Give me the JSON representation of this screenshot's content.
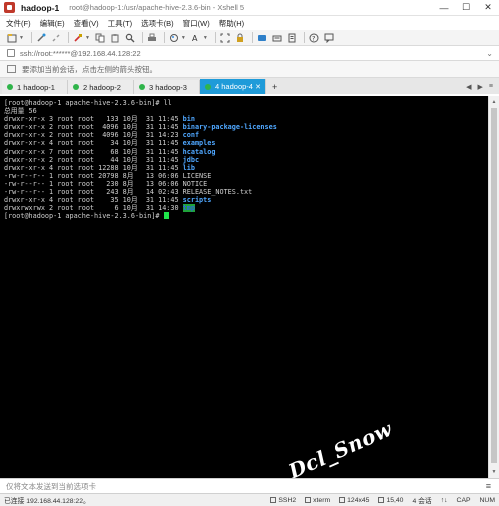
{
  "window": {
    "name": "hadoop-1",
    "path": "root@hadoop-1:/usr/apache-hive-2.3.6-bin - Xshell 5"
  },
  "controls": {
    "minimize": "—",
    "maximize": "☐",
    "close": "✕"
  },
  "menu": [
    "文件(F)",
    "编辑(E)",
    "查看(V)",
    "工具(T)",
    "选项卡(B)",
    "窗口(W)",
    "帮助(H)"
  ],
  "address": {
    "text": "ssh://root:******@192.168.44.128:22"
  },
  "info": {
    "text": "要添加当前会话，点击左侧的箭头按钮。"
  },
  "tabs": [
    {
      "label": "1 hadoop-1",
      "active": false
    },
    {
      "label": "2 hadoop-2",
      "active": false
    },
    {
      "label": "3 hadoop-3",
      "active": false
    },
    {
      "label": "4 hadoop-4",
      "active": true
    }
  ],
  "tab_add": "+",
  "terminal": {
    "prompt_first": "[root@hadoop-1 apache-hive-2.3.6-bin]# ll",
    "total": "总用量 56",
    "rows": [
      {
        "prefix": "drwxr-xr-x 3 root root   133 10月  31 11:45 ",
        "name": "bin",
        "kind": "dir"
      },
      {
        "prefix": "drwxr-xr-x 2 root root  4096 10月  31 11:45 ",
        "name": "binary-package-licenses",
        "kind": "dir"
      },
      {
        "prefix": "drwxr-xr-x 2 root root  4096 10月  31 14:23 ",
        "name": "conf",
        "kind": "dir"
      },
      {
        "prefix": "drwxr-xr-x 4 root root    34 10月  31 11:45 ",
        "name": "examples",
        "kind": "dir"
      },
      {
        "prefix": "drwxr-xr-x 7 root root    68 10月  31 11:45 ",
        "name": "hcatalog",
        "kind": "dir"
      },
      {
        "prefix": "drwxr-xr-x 2 root root    44 10月  31 11:45 ",
        "name": "jdbc",
        "kind": "dir"
      },
      {
        "prefix": "drwxr-xr-x 4 root root 12288 10月  31 11:45 ",
        "name": "lib",
        "kind": "dir"
      },
      {
        "prefix": "-rw-r--r-- 1 root root 20798 8月   13 06:06 ",
        "name": "LICENSE",
        "kind": "file"
      },
      {
        "prefix": "-rw-r--r-- 1 root root   230 8月   13 06:06 ",
        "name": "NOTICE",
        "kind": "file"
      },
      {
        "prefix": "-rw-r--r-- 1 root root   243 8月   14 02:43 ",
        "name": "RELEASE_NOTES.txt",
        "kind": "file"
      },
      {
        "prefix": "drwxr-xr-x 4 root root    35 10月  31 11:45 ",
        "name": "scripts",
        "kind": "dir"
      },
      {
        "prefix": "drwxrwxrwx 2 root root     6 10月  31 14:30 ",
        "name": "tmp",
        "kind": "hl"
      }
    ],
    "prompt_last": "[root@hadoop-1 apache-hive-2.3.6-bin]# "
  },
  "watermark": "Dcl_Snow",
  "compose": {
    "placeholder": "仅将文本发送到当前选项卡"
  },
  "status": {
    "connection": "已连接 192.168.44.128:22。",
    "protocol": "SSH2",
    "terminal_type": "xterm",
    "size": "124x45",
    "cursor": "15,40",
    "sessions": "4 会话",
    "caps": "CAP",
    "num": "NUM"
  },
  "colors": {
    "terminal_bg": "#000000",
    "dir": "#4fa7ff",
    "highlight_bg": "#1fa33a",
    "active_tab": "#1f9bd9",
    "session_dot": "#2fb44a",
    "cursor": "#1ee34a"
  }
}
